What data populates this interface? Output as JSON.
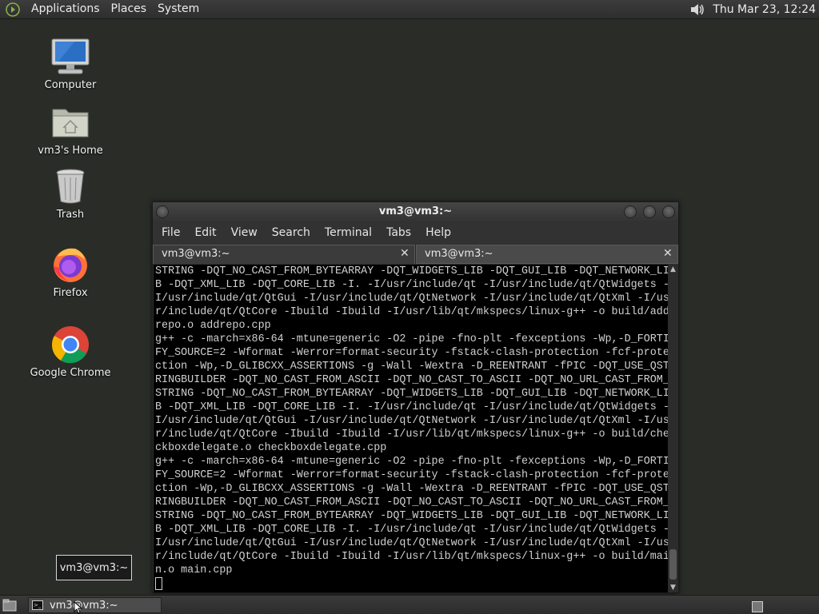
{
  "top_panel": {
    "menus": [
      "Applications",
      "Places",
      "System"
    ],
    "clock": "Thu Mar 23, 12:24",
    "volume_icon": "volume-icon"
  },
  "desktop_icons": [
    {
      "label": "Computer",
      "icon": "computer-icon"
    },
    {
      "label": "vm3's Home",
      "icon": "home-folder-icon"
    },
    {
      "label": "Trash",
      "icon": "trash-icon"
    },
    {
      "label": "Firefox",
      "icon": "firefox-icon"
    },
    {
      "label": "Google Chrome",
      "icon": "chrome-icon"
    }
  ],
  "tooltip": {
    "text": "vm3@vm3:~"
  },
  "terminal": {
    "title": "vm3@vm3:~",
    "menu": [
      "File",
      "Edit",
      "View",
      "Search",
      "Terminal",
      "Tabs",
      "Help"
    ],
    "tabs": [
      {
        "label": "vm3@vm3:~",
        "active": true
      },
      {
        "label": "vm3@vm3:~",
        "active": false
      }
    ],
    "lines": [
      "STRING -DQT_NO_CAST_FROM_BYTEARRAY -DQT_WIDGETS_LIB -DQT_GUI_LIB -DQT_NETWORK_LI",
      "B -DQT_XML_LIB -DQT_CORE_LIB -I. -I/usr/include/qt -I/usr/include/qt/QtWidgets -",
      "I/usr/include/qt/QtGui -I/usr/include/qt/QtNetwork -I/usr/include/qt/QtXml -I/us",
      "r/include/qt/QtCore -Ibuild -Ibuild -I/usr/lib/qt/mkspecs/linux-g++ -o build/add",
      "repo.o addrepo.cpp",
      "g++ -c -march=x86-64 -mtune=generic -O2 -pipe -fno-plt -fexceptions -Wp,-D_FORTI",
      "FY_SOURCE=2 -Wformat -Werror=format-security -fstack-clash-protection -fcf-prote",
      "ction -Wp,-D_GLIBCXX_ASSERTIONS -g -Wall -Wextra -D_REENTRANT -fPIC -DQT_USE_QST",
      "RINGBUILDER -DQT_NO_CAST_FROM_ASCII -DQT_NO_CAST_TO_ASCII -DQT_NO_URL_CAST_FROM_",
      "STRING -DQT_NO_CAST_FROM_BYTEARRAY -DQT_WIDGETS_LIB -DQT_GUI_LIB -DQT_NETWORK_LI",
      "B -DQT_XML_LIB -DQT_CORE_LIB -I. -I/usr/include/qt -I/usr/include/qt/QtWidgets -",
      "I/usr/include/qt/QtGui -I/usr/include/qt/QtNetwork -I/usr/include/qt/QtXml -I/us",
      "r/include/qt/QtCore -Ibuild -Ibuild -I/usr/lib/qt/mkspecs/linux-g++ -o build/che",
      "ckboxdelegate.o checkboxdelegate.cpp",
      "g++ -c -march=x86-64 -mtune=generic -O2 -pipe -fno-plt -fexceptions -Wp,-D_FORTI",
      "FY_SOURCE=2 -Wformat -Werror=format-security -fstack-clash-protection -fcf-prote",
      "ction -Wp,-D_GLIBCXX_ASSERTIONS -g -Wall -Wextra -D_REENTRANT -fPIC -DQT_USE_QST",
      "RINGBUILDER -DQT_NO_CAST_FROM_ASCII -DQT_NO_CAST_TO_ASCII -DQT_NO_URL_CAST_FROM_",
      "STRING -DQT_NO_CAST_FROM_BYTEARRAY -DQT_WIDGETS_LIB -DQT_GUI_LIB -DQT_NETWORK_LI",
      "B -DQT_XML_LIB -DQT_CORE_LIB -I. -I/usr/include/qt -I/usr/include/qt/QtWidgets -",
      "I/usr/include/qt/QtGui -I/usr/include/qt/QtNetwork -I/usr/include/qt/QtXml -I/us",
      "r/include/qt/QtCore -Ibuild -Ibuild -I/usr/lib/qt/mkspecs/linux-g++ -o build/mai",
      "n.o main.cpp"
    ]
  },
  "taskbar": {
    "task_label": "vm3@vm3:~"
  }
}
